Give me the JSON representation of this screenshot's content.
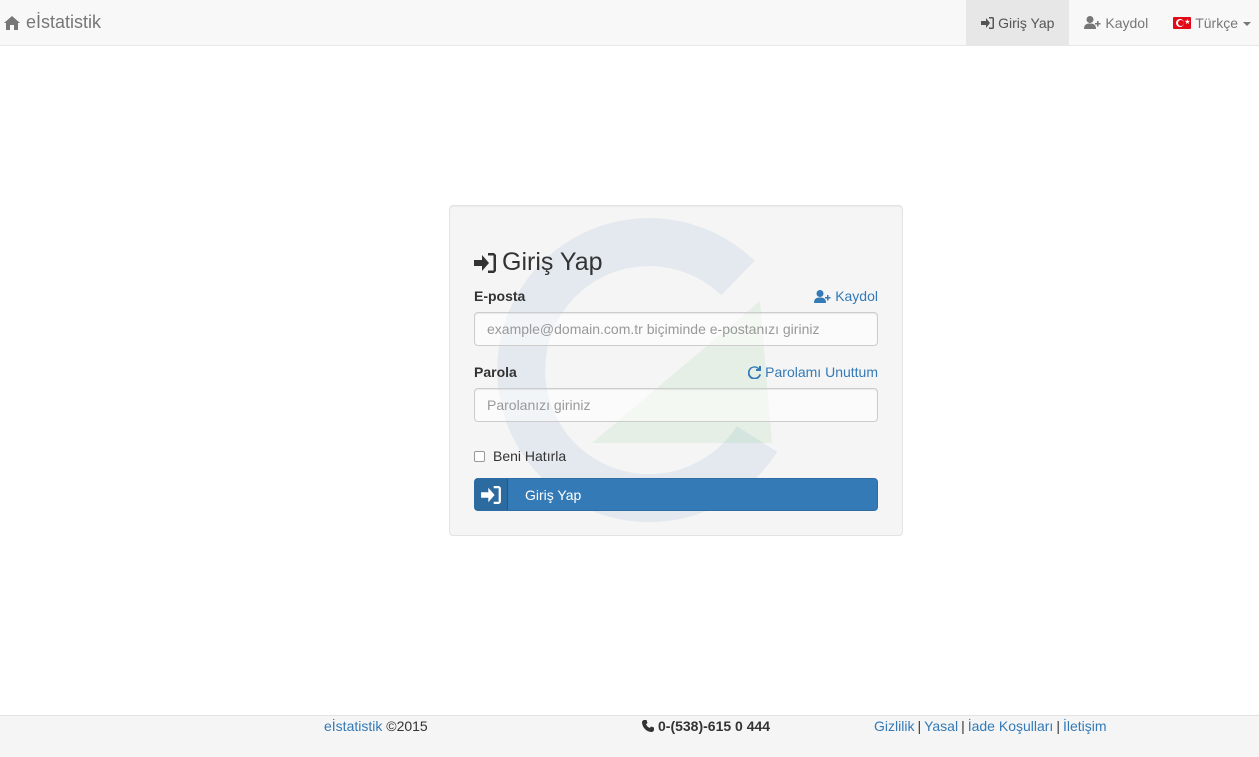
{
  "navbar": {
    "brand": "eİstatistik",
    "login": "Giriş Yap",
    "register": "Kaydol",
    "language": "Türkçe"
  },
  "login_panel": {
    "title": "Giriş Yap",
    "email_label": "E-posta",
    "register_link": "Kaydol",
    "email_placeholder": "example@domain.com.tr biçiminde e-postanızı giriniz",
    "password_label": "Parola",
    "forgot_link": "Parolamı Unuttum",
    "password_placeholder": "Parolanızı giriniz",
    "remember_label": "Beni Hatırla",
    "submit_label": "Giriş Yap"
  },
  "footer": {
    "brand_link": "eİstatistik",
    "copyright": "©2015",
    "phone": "0-(538)-615 0 444",
    "links": [
      "Gizlilik",
      "Yasal",
      "İade Koşulları",
      "İletişim"
    ],
    "separator": "|"
  },
  "colors": {
    "accent": "#337ab7",
    "navbar_bg": "#f8f8f8",
    "panel_bg": "#f5f5f5"
  },
  "icons": {
    "brand": "home-icon",
    "login": "sign-in-icon",
    "register": "user-plus-icon",
    "language": "turkish-flag-icon",
    "forgot": "refresh-icon",
    "phone": "phone-icon"
  }
}
